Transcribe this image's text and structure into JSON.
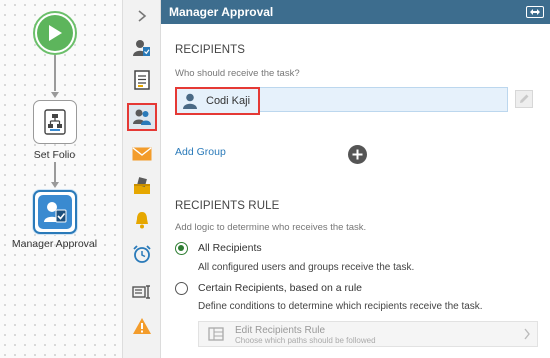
{
  "workflow": {
    "nodes": [
      {
        "label": "Set Folio"
      },
      {
        "label": "Manager Approval"
      }
    ]
  },
  "toolbar": {
    "items": [
      "collapse-icon",
      "participant-icon",
      "form-icon",
      "recipients-icon",
      "email-icon",
      "vote-icon",
      "notification-icon",
      "timer-icon",
      "escalation-icon",
      "warning-icon"
    ],
    "active": "recipients-icon"
  },
  "panel": {
    "title": "Manager Approval",
    "recipients": {
      "heading": "RECIPIENTS",
      "hint": "Who should receive the task?",
      "selected": "Codi Kaji",
      "add_group": "Add Group"
    },
    "rule": {
      "heading": "RECIPIENTS RULE",
      "hint": "Add logic to determine who receives the task.",
      "options": [
        {
          "label": "All Recipients",
          "description": "All configured users and groups receive the task.",
          "checked": true
        },
        {
          "label": "Certain Recipients, based on a rule",
          "description": "Define conditions to determine which recipients receive the task.",
          "checked": false
        }
      ],
      "edit_button": {
        "title": "Edit Recipients Rule",
        "subtitle": "Choose which paths should be followed"
      }
    }
  },
  "colors": {
    "header": "#3d6d8e",
    "accent": "#2a7ab9",
    "highlight": "#e53935",
    "start": "#5db55c"
  }
}
